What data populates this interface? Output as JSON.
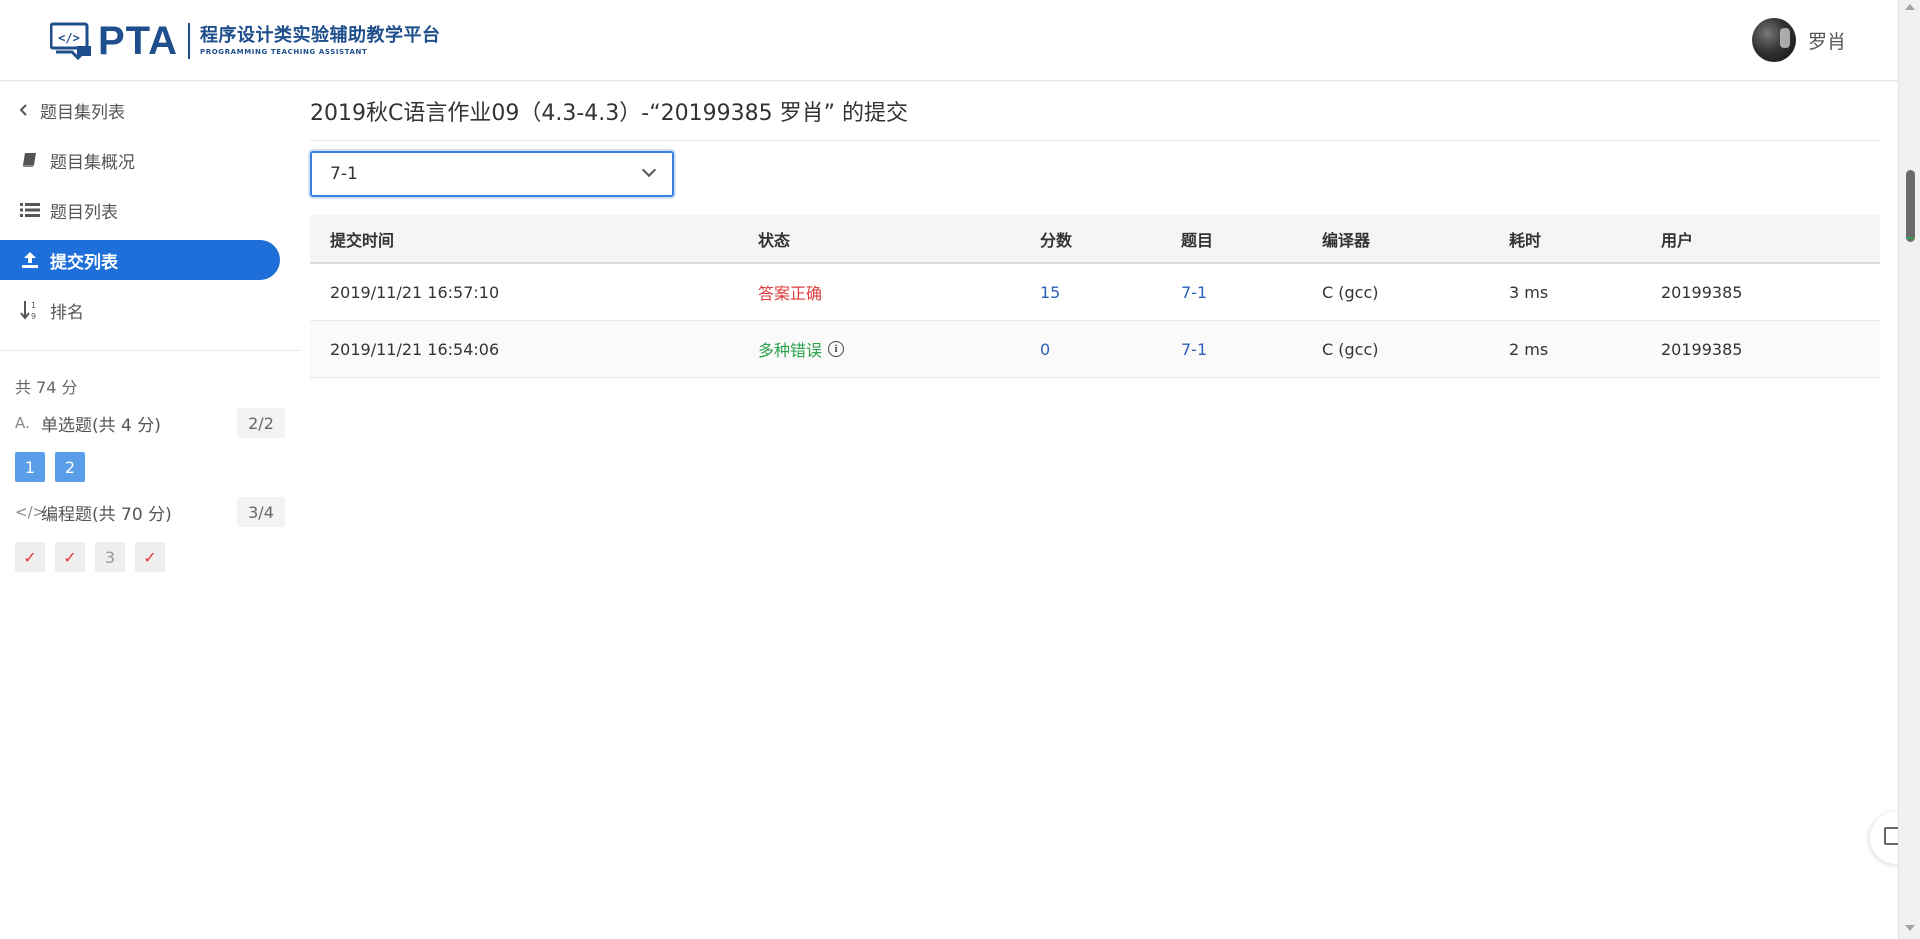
{
  "header": {
    "logo_main": "PTA",
    "logo_cn": "程序设计类实验辅助教学平台",
    "logo_en": "PROGRAMMING TEACHING ASSISTANT",
    "user_name": "罗肖"
  },
  "sidebar": {
    "back_label": "题目集列表",
    "items": [
      {
        "label": "题目集概况",
        "icon": "book-icon"
      },
      {
        "label": "题目列表",
        "icon": "list-icon"
      },
      {
        "label": "提交列表",
        "icon": "upload-icon",
        "active": true
      },
      {
        "label": "排名",
        "icon": "sort-numeric-icon"
      }
    ],
    "total": "共 74 分",
    "sections": [
      {
        "label": "单选题(共 4 分)",
        "count": "2/2",
        "chips": [
          "1",
          "2"
        ]
      },
      {
        "label": "编程题(共 70 分)",
        "count": "3/4",
        "chips": [
          "✓",
          "✓",
          "3",
          "✓"
        ]
      }
    ]
  },
  "main": {
    "title": "2019秋C语言作业09（4.3-4.3）-“20199385 罗肖” 的提交",
    "select_value": "7-1",
    "columns": [
      "提交时间",
      "状态",
      "分数",
      "题目",
      "编译器",
      "耗时",
      "用户"
    ],
    "rows": [
      {
        "time": "2019/11/21 16:57:10",
        "status": "答案正确",
        "score": "15",
        "problem": "7-1",
        "compiler": "C (gcc)",
        "duration": "3 ms",
        "user": "20199385"
      },
      {
        "time": "2019/11/21 16:54:06",
        "status": "多种错误",
        "score": "0",
        "problem": "7-1",
        "compiler": "C (gcc)",
        "duration": "2 ms",
        "user": "20199385"
      }
    ]
  },
  "colors": {
    "accent": "#1e6fd9",
    "brand": "#1f4e8c",
    "status_ok": "#e23b3b",
    "status_err": "#2aa34a",
    "link": "#2b61b8"
  }
}
